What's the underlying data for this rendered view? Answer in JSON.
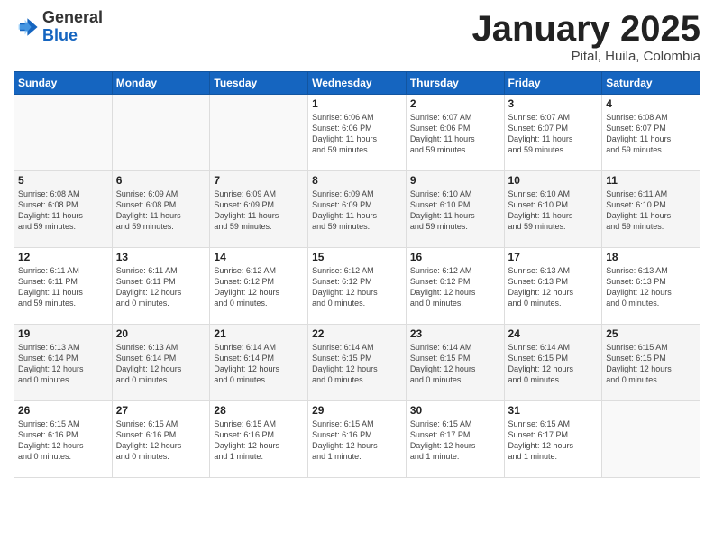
{
  "header": {
    "logo_general": "General",
    "logo_blue": "Blue",
    "month_title": "January 2025",
    "subtitle": "Pital, Huila, Colombia"
  },
  "weekdays": [
    "Sunday",
    "Monday",
    "Tuesday",
    "Wednesday",
    "Thursday",
    "Friday",
    "Saturday"
  ],
  "weeks": [
    [
      {
        "day": "",
        "info": ""
      },
      {
        "day": "",
        "info": ""
      },
      {
        "day": "",
        "info": ""
      },
      {
        "day": "1",
        "info": "Sunrise: 6:06 AM\nSunset: 6:06 PM\nDaylight: 11 hours\nand 59 minutes."
      },
      {
        "day": "2",
        "info": "Sunrise: 6:07 AM\nSunset: 6:06 PM\nDaylight: 11 hours\nand 59 minutes."
      },
      {
        "day": "3",
        "info": "Sunrise: 6:07 AM\nSunset: 6:07 PM\nDaylight: 11 hours\nand 59 minutes."
      },
      {
        "day": "4",
        "info": "Sunrise: 6:08 AM\nSunset: 6:07 PM\nDaylight: 11 hours\nand 59 minutes."
      }
    ],
    [
      {
        "day": "5",
        "info": "Sunrise: 6:08 AM\nSunset: 6:08 PM\nDaylight: 11 hours\nand 59 minutes."
      },
      {
        "day": "6",
        "info": "Sunrise: 6:09 AM\nSunset: 6:08 PM\nDaylight: 11 hours\nand 59 minutes."
      },
      {
        "day": "7",
        "info": "Sunrise: 6:09 AM\nSunset: 6:09 PM\nDaylight: 11 hours\nand 59 minutes."
      },
      {
        "day": "8",
        "info": "Sunrise: 6:09 AM\nSunset: 6:09 PM\nDaylight: 11 hours\nand 59 minutes."
      },
      {
        "day": "9",
        "info": "Sunrise: 6:10 AM\nSunset: 6:10 PM\nDaylight: 11 hours\nand 59 minutes."
      },
      {
        "day": "10",
        "info": "Sunrise: 6:10 AM\nSunset: 6:10 PM\nDaylight: 11 hours\nand 59 minutes."
      },
      {
        "day": "11",
        "info": "Sunrise: 6:11 AM\nSunset: 6:10 PM\nDaylight: 11 hours\nand 59 minutes."
      }
    ],
    [
      {
        "day": "12",
        "info": "Sunrise: 6:11 AM\nSunset: 6:11 PM\nDaylight: 11 hours\nand 59 minutes."
      },
      {
        "day": "13",
        "info": "Sunrise: 6:11 AM\nSunset: 6:11 PM\nDaylight: 12 hours\nand 0 minutes."
      },
      {
        "day": "14",
        "info": "Sunrise: 6:12 AM\nSunset: 6:12 PM\nDaylight: 12 hours\nand 0 minutes."
      },
      {
        "day": "15",
        "info": "Sunrise: 6:12 AM\nSunset: 6:12 PM\nDaylight: 12 hours\nand 0 minutes."
      },
      {
        "day": "16",
        "info": "Sunrise: 6:12 AM\nSunset: 6:12 PM\nDaylight: 12 hours\nand 0 minutes."
      },
      {
        "day": "17",
        "info": "Sunrise: 6:13 AM\nSunset: 6:13 PM\nDaylight: 12 hours\nand 0 minutes."
      },
      {
        "day": "18",
        "info": "Sunrise: 6:13 AM\nSunset: 6:13 PM\nDaylight: 12 hours\nand 0 minutes."
      }
    ],
    [
      {
        "day": "19",
        "info": "Sunrise: 6:13 AM\nSunset: 6:14 PM\nDaylight: 12 hours\nand 0 minutes."
      },
      {
        "day": "20",
        "info": "Sunrise: 6:13 AM\nSunset: 6:14 PM\nDaylight: 12 hours\nand 0 minutes."
      },
      {
        "day": "21",
        "info": "Sunrise: 6:14 AM\nSunset: 6:14 PM\nDaylight: 12 hours\nand 0 minutes."
      },
      {
        "day": "22",
        "info": "Sunrise: 6:14 AM\nSunset: 6:15 PM\nDaylight: 12 hours\nand 0 minutes."
      },
      {
        "day": "23",
        "info": "Sunrise: 6:14 AM\nSunset: 6:15 PM\nDaylight: 12 hours\nand 0 minutes."
      },
      {
        "day": "24",
        "info": "Sunrise: 6:14 AM\nSunset: 6:15 PM\nDaylight: 12 hours\nand 0 minutes."
      },
      {
        "day": "25",
        "info": "Sunrise: 6:15 AM\nSunset: 6:15 PM\nDaylight: 12 hours\nand 0 minutes."
      }
    ],
    [
      {
        "day": "26",
        "info": "Sunrise: 6:15 AM\nSunset: 6:16 PM\nDaylight: 12 hours\nand 0 minutes."
      },
      {
        "day": "27",
        "info": "Sunrise: 6:15 AM\nSunset: 6:16 PM\nDaylight: 12 hours\nand 0 minutes."
      },
      {
        "day": "28",
        "info": "Sunrise: 6:15 AM\nSunset: 6:16 PM\nDaylight: 12 hours\nand 1 minute."
      },
      {
        "day": "29",
        "info": "Sunrise: 6:15 AM\nSunset: 6:16 PM\nDaylight: 12 hours\nand 1 minute."
      },
      {
        "day": "30",
        "info": "Sunrise: 6:15 AM\nSunset: 6:17 PM\nDaylight: 12 hours\nand 1 minute."
      },
      {
        "day": "31",
        "info": "Sunrise: 6:15 AM\nSunset: 6:17 PM\nDaylight: 12 hours\nand 1 minute."
      },
      {
        "day": "",
        "info": ""
      }
    ]
  ]
}
